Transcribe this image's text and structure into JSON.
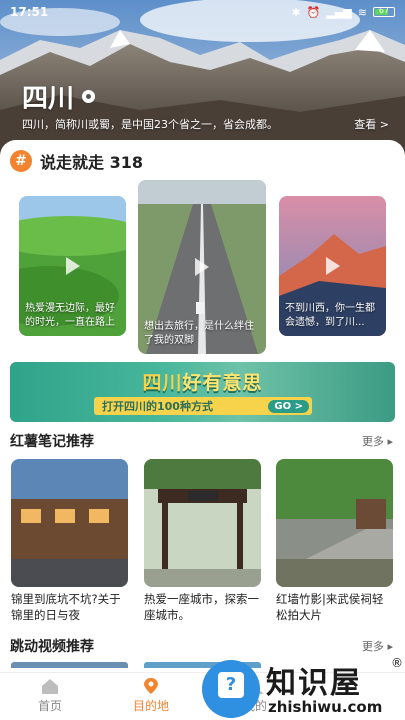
{
  "status_bar": {
    "time": "17:51",
    "battery": "67"
  },
  "hero": {
    "title": "四川",
    "description": "四川，简称川或蜀，是中国23个省之一，省会成都。",
    "more_label": "查看 >"
  },
  "topic": {
    "icon_glyph": "#",
    "title": "说走就走 318"
  },
  "topic_cards": [
    {
      "caption": "热爱漫无边际，最好的时光，一直在路上"
    },
    {
      "caption": "想出去旅行，是什么绊住了我的双脚"
    },
    {
      "caption": "不到川西，你一生都会遗憾，到了川..."
    }
  ],
  "banner": {
    "title_a": "四川",
    "title_b": "好有意思",
    "subtitle": "打开四川的100种方式",
    "go_label": "GO >"
  },
  "notes_section": {
    "title": "红薯笔记推荐",
    "more_label": "更多 ▸"
  },
  "notes": [
    {
      "text": "锦里到底坑不坑?关于锦里的日与夜"
    },
    {
      "text": "热爱一座城市，探索一座城市。"
    },
    {
      "text": "红墙竹影|来武侯祠轻松拍大片"
    }
  ],
  "videos_section": {
    "title": "跳动视频推荐",
    "more_label": "更多 ▸"
  },
  "tabbar": {
    "items": [
      {
        "label": "首页"
      },
      {
        "label": "目的地"
      },
      {
        "label": "我的"
      }
    ],
    "active_color": "#f3842f"
  },
  "watermark": {
    "name": "知识屋",
    "url": "zhishiwu.com",
    "reg": "®",
    "icon_glyph": "?"
  }
}
